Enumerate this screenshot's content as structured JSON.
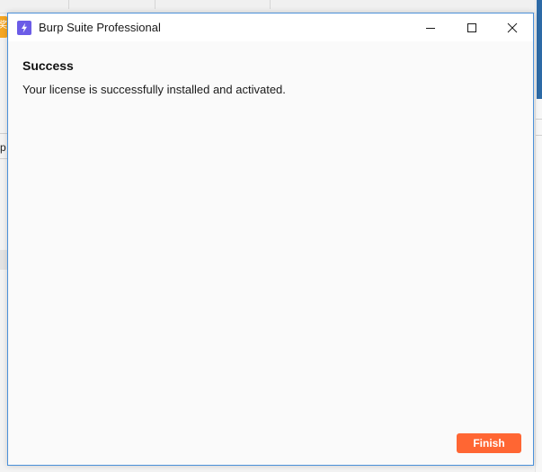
{
  "window": {
    "title": "Burp Suite Professional",
    "app_icon": "burp-lightning-icon",
    "controls": {
      "minimize_icon": "minimize-icon",
      "maximize_icon": "maximize-icon",
      "close_icon": "close-icon"
    }
  },
  "dialog": {
    "heading": "Success",
    "message": "Your license is successfully installed and activated.",
    "finish_label": "Finish"
  },
  "background": {
    "orange_tab_text": "奖",
    "left_text_fragment": "p"
  },
  "colors": {
    "accent": "#ff6633",
    "app_icon": "#6b5ce7",
    "window_border": "#4a90d9"
  }
}
